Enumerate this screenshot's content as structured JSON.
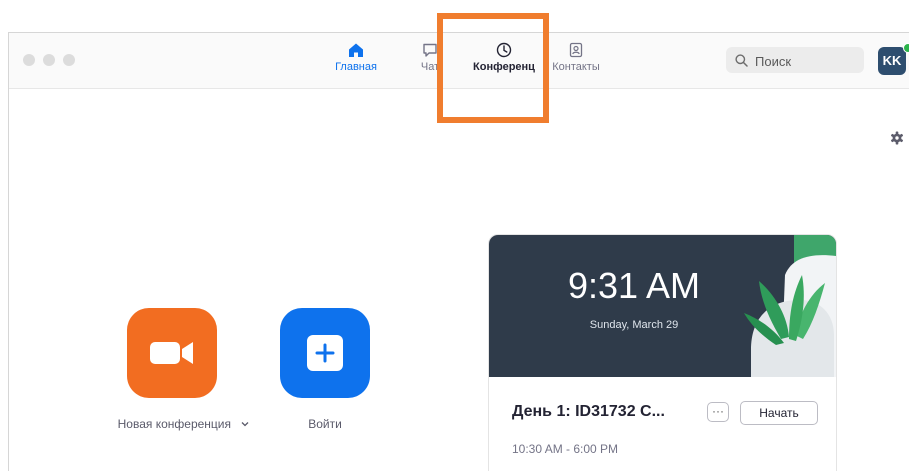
{
  "nav": {
    "tabs": [
      {
        "label": "Главная",
        "icon": "home-icon"
      },
      {
        "label": "Чат",
        "icon": "chat-icon"
      },
      {
        "label": "Конференц",
        "icon": "clock-icon"
      },
      {
        "label": "Контакты",
        "icon": "contacts-icon"
      }
    ]
  },
  "search": {
    "placeholder": "Поиск"
  },
  "user": {
    "initials": "KK"
  },
  "actions": {
    "new_meeting_label": "Новая конференция",
    "join_label": "Войти"
  },
  "card": {
    "time": "9:31 AM",
    "date": "Sunday, March 29",
    "meeting_title": "День 1: ID31732 C...",
    "more_label": "···",
    "start_label": "Начать",
    "meeting_time": "10:30 AM - 6:00 PM"
  },
  "colors": {
    "accent": "#0e72ed",
    "new_meeting": "#f26d21",
    "join": "#0e72ed",
    "highlight": "#f07d2e",
    "card_header": "#2f3b4a"
  }
}
